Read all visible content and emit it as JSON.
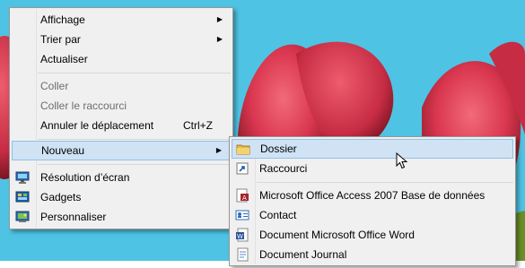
{
  "context_menu": {
    "items": [
      {
        "label": "Affichage",
        "submenu": true
      },
      {
        "label": "Trier par",
        "submenu": true
      },
      {
        "label": "Actualiser"
      },
      {
        "label": "Coller",
        "disabled": true
      },
      {
        "label": "Coller le raccourci",
        "disabled": true
      },
      {
        "label": "Annuler le déplacement",
        "shortcut": "Ctrl+Z"
      },
      {
        "label": "Nouveau",
        "submenu": true,
        "highlighted": true
      },
      {
        "label": "Résolution d’écran",
        "icon": "display-icon"
      },
      {
        "label": "Gadgets",
        "icon": "gadgets-icon"
      },
      {
        "label": "Personnaliser",
        "icon": "personalize-icon"
      }
    ]
  },
  "new_submenu": {
    "items": [
      {
        "label": "Dossier",
        "icon": "folder-icon",
        "highlighted": true
      },
      {
        "label": "Raccourci",
        "icon": "shortcut-icon"
      },
      {
        "label": "Microsoft Office Access 2007 Base de données",
        "icon": "access-icon"
      },
      {
        "label": "Contact",
        "icon": "contact-icon"
      },
      {
        "label": "Document Microsoft Office Word",
        "icon": "word-icon"
      },
      {
        "label": "Document Journal",
        "icon": "journal-icon"
      }
    ]
  },
  "colors": {
    "sky": "#4fc3e3",
    "tulip": "#d9364f",
    "menu_bg": "#f0f0f0",
    "highlight": "#cfe3f5",
    "highlight_border": "#93bfe4"
  }
}
